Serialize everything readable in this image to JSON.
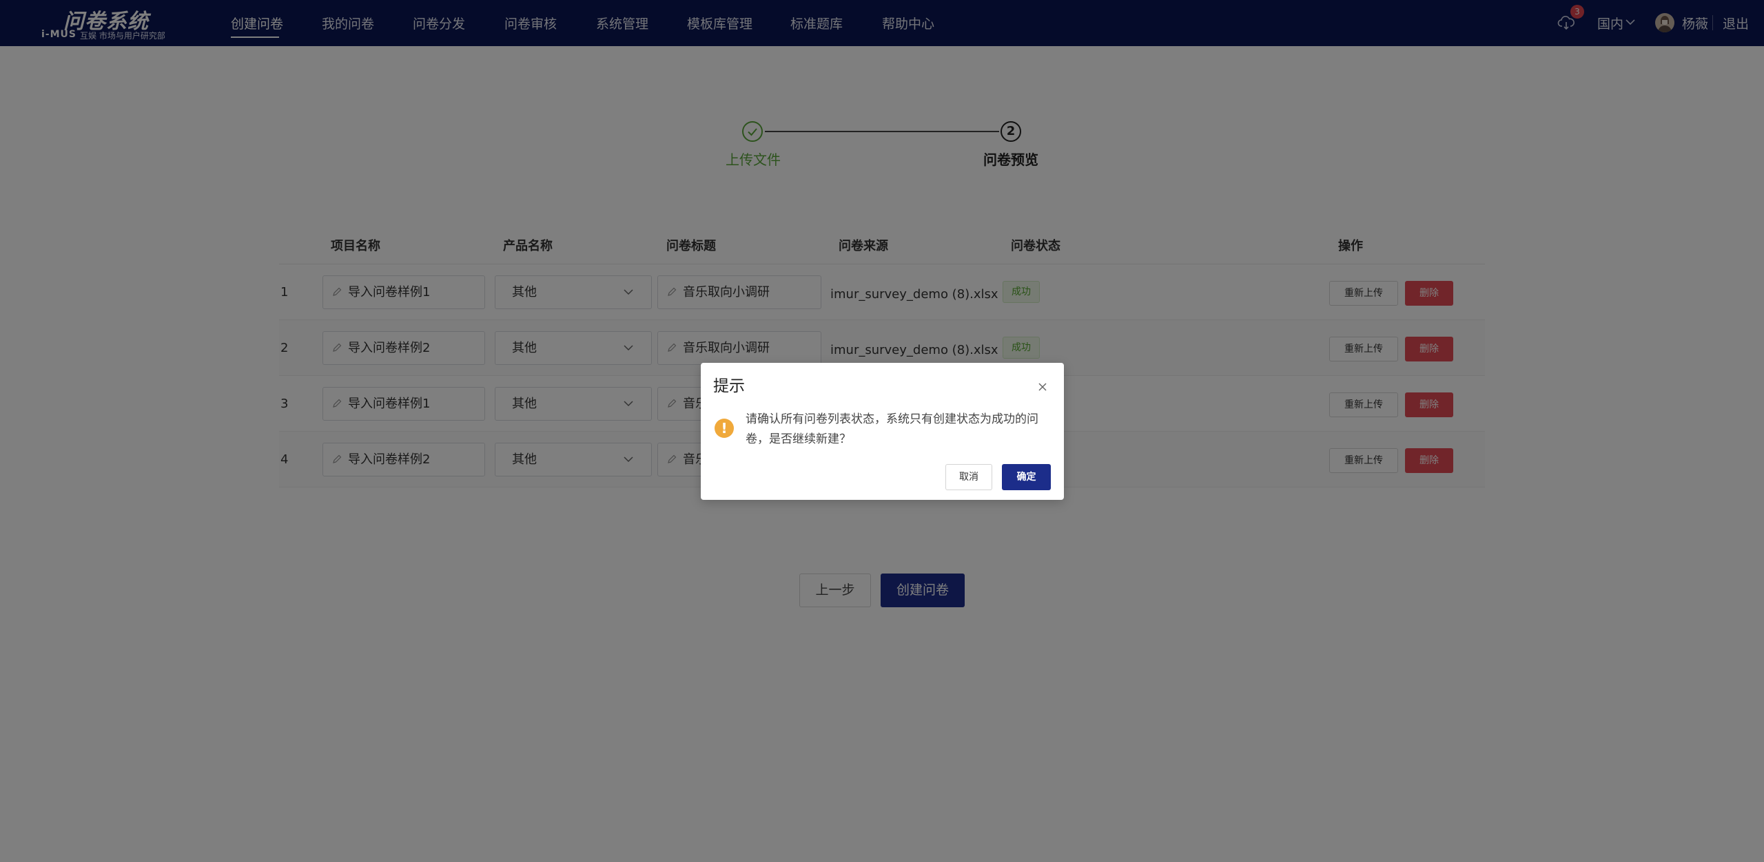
{
  "nav": {
    "logo_title": "问卷系统",
    "logo_mark": "i-MUS",
    "logo_subtitle": "互娱 市场与用户研究部",
    "items": [
      "创建问卷",
      "我的问卷",
      "问卷分发",
      "问卷审核",
      "系统管理",
      "模板库管理",
      "标准题库",
      "帮助中心"
    ],
    "active_index": 0,
    "notification_count": "3",
    "region": "国内",
    "username": "杨薇",
    "logout": "退出"
  },
  "steps": {
    "step1_label": "上传文件",
    "step1_status": "completed",
    "step2_number": "2",
    "step2_label": "问卷预览",
    "step2_status": "current"
  },
  "table": {
    "headers": [
      "项目名称",
      "产品名称",
      "问卷标题",
      "问卷来源",
      "问卷状态",
      "操作"
    ],
    "rows": [
      {
        "index": "1",
        "project": "导入问卷样例1",
        "product": "其他",
        "title": "音乐取向小调研",
        "source": "imur_survey_demo (8).xlsx 问...",
        "status": "成功",
        "reupload": "重新上传",
        "delete": "删除"
      },
      {
        "index": "2",
        "project": "导入问卷样例2",
        "product": "其他",
        "title": "音乐取向小调研",
        "source": "imur_survey_demo (8).xlsx 问...",
        "status": "成功",
        "reupload": "重新上传",
        "delete": "删除"
      },
      {
        "index": "3",
        "project": "导入问卷样例1",
        "product": "其他",
        "title": "音乐取向小调研",
        "source": "",
        "status": "",
        "reupload": "重新上传",
        "delete": "删除"
      },
      {
        "index": "4",
        "project": "导入问卷样例2",
        "product": "其他",
        "title": "音乐取向小调研",
        "source": "",
        "status": "",
        "reupload": "重新上传",
        "delete": "删除"
      }
    ]
  },
  "actions": {
    "prev_label": "上一步",
    "create_label": "创建问卷"
  },
  "modal": {
    "title": "提示",
    "message": "请确认所有问卷列表状态，系统只有创建状态为成功的问卷，是否继续新建？",
    "cancel_label": "取消",
    "ok_label": "确定"
  },
  "colors": {
    "nav_bg": "#0b1654",
    "primary": "#1c2d8a",
    "success": "#5aa63b",
    "danger": "#e34a55",
    "warning": "#f0a93b"
  },
  "icons": {
    "cloud": "cloud-download-icon",
    "step_check": "check-icon",
    "edit": "pen-icon",
    "chevron": "chevron-down-icon",
    "close": "close-icon",
    "warning": "exclamation-icon"
  }
}
